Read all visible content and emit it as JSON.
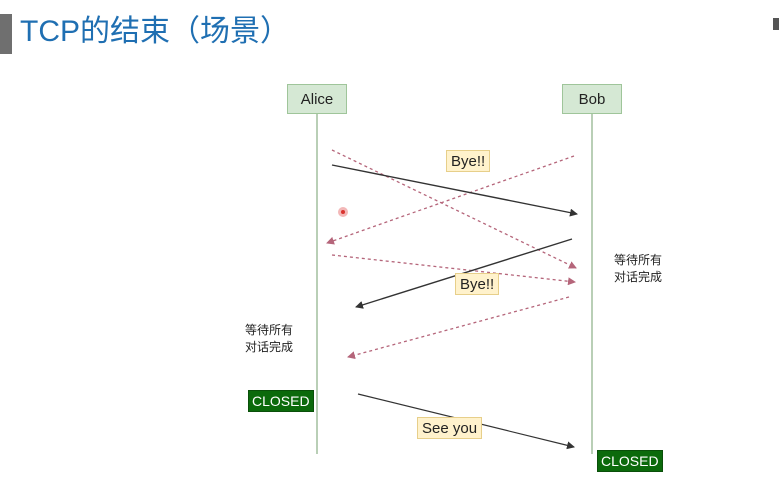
{
  "slide": {
    "title": "TCP的结束（场景）"
  },
  "actors": {
    "left": "Alice",
    "right": "Bob"
  },
  "messages": {
    "bye_first": "Bye!!",
    "bye_second": "Bye!!",
    "see_you": "See you"
  },
  "notes": {
    "right_line1": "等待所有",
    "right_line2": "对话完成",
    "left_line1": "等待所有",
    "left_line2": "对话完成"
  },
  "states": {
    "left_closed": "CLOSED",
    "right_closed": "CLOSED"
  },
  "colors": {
    "title": "#1f6fb2",
    "actor_fill": "#d5e8d4",
    "label_fill": "#fff2cc",
    "closed_fill": "#0b6a0b",
    "solid_arrow": "#333333",
    "dotted_arrow": "#b5657a"
  }
}
